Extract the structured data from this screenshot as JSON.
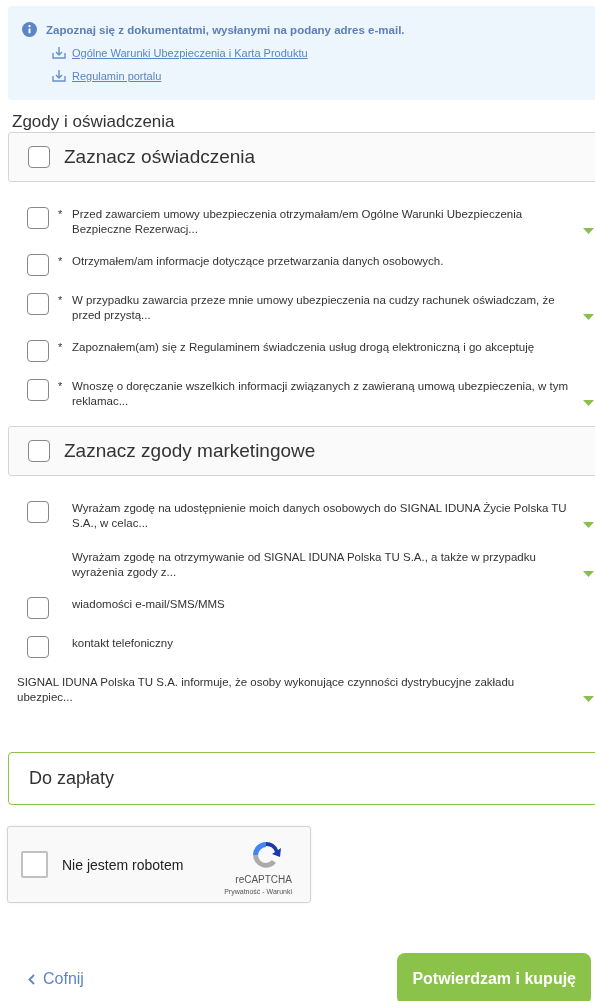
{
  "info": {
    "text": "Zapoznaj się z dokumentatmi, wysłanymi na podany adres e-mail.",
    "links": [
      "Ogólne Warunki Ubezpieczenia i Karta Produktu",
      "Regulamin portalu"
    ]
  },
  "section_title": "Zgody i oświadczenia",
  "groups": [
    {
      "title": "Zaznacz oświadczenia",
      "checked": false,
      "items": [
        {
          "kind": "checkbox",
          "checked": false,
          "marker": "*",
          "expandable": true,
          "text": "Przed zawarciem umowy ubezpieczenia otrzymałam/em Ogólne Warunki Ubezpieczenia Bezpieczne Rezerwacj..."
        },
        {
          "kind": "checkbox",
          "checked": false,
          "marker": "*",
          "expandable": false,
          "text": "Otrzymałem/am informacje dotyczące przetwarzania danych osobowych."
        },
        {
          "kind": "checkbox",
          "checked": false,
          "marker": "*",
          "expandable": true,
          "text": "W przypadku zawarcia przeze mnie umowy ubezpieczenia na cudzy rachunek oświadczam, że przed przystą..."
        },
        {
          "kind": "checkbox",
          "checked": false,
          "marker": "*",
          "expandable": false,
          "text": "Zapoznałem(am) się z Regulaminem świadczenia usług drogą elektroniczną i go akceptuję"
        },
        {
          "kind": "checkbox",
          "checked": false,
          "marker": "*",
          "expandable": true,
          "text": "Wnoszę o doręczanie wszelkich informacji związanych z zawieraną umową ubezpieczenia, w tym reklamac..."
        }
      ]
    },
    {
      "title": "Zaznacz zgody marketingowe",
      "checked": false,
      "items": [
        {
          "kind": "checkbox",
          "checked": false,
          "expandable": true,
          "text": "Wyrażam zgodę na udostępnienie moich danych osobowych do SIGNAL IDUNA Życie Polska TU S.A., w celac..."
        },
        {
          "kind": "text",
          "expandable": true,
          "text": "Wyrażam zgodę na otrzymywanie od SIGNAL IDUNA Polska TU S.A., a także w przypadku wyrażenia zgody z..."
        },
        {
          "kind": "checkbox",
          "checked": false,
          "expandable": false,
          "text": "wiadomości e-mail/SMS/MMS"
        },
        {
          "kind": "checkbox",
          "checked": false,
          "expandable": false,
          "text": "kontakt telefoniczny"
        },
        {
          "kind": "note",
          "expandable": true,
          "text": "SIGNAL IDUNA Polska TU S.A. informuje, że osoby wykonujące czynności dystrybucyjne zakładu ubezpiec..."
        }
      ]
    }
  ],
  "payment": {
    "label": "Do zapłaty"
  },
  "captcha": {
    "checked": false,
    "label": "Nie jestem robotem",
    "brand": "reCAPTCHA",
    "links": "Prywatność - Warunki"
  },
  "actions": {
    "back": "Cofnij",
    "submit": "Potwierdzam i kupuję"
  }
}
